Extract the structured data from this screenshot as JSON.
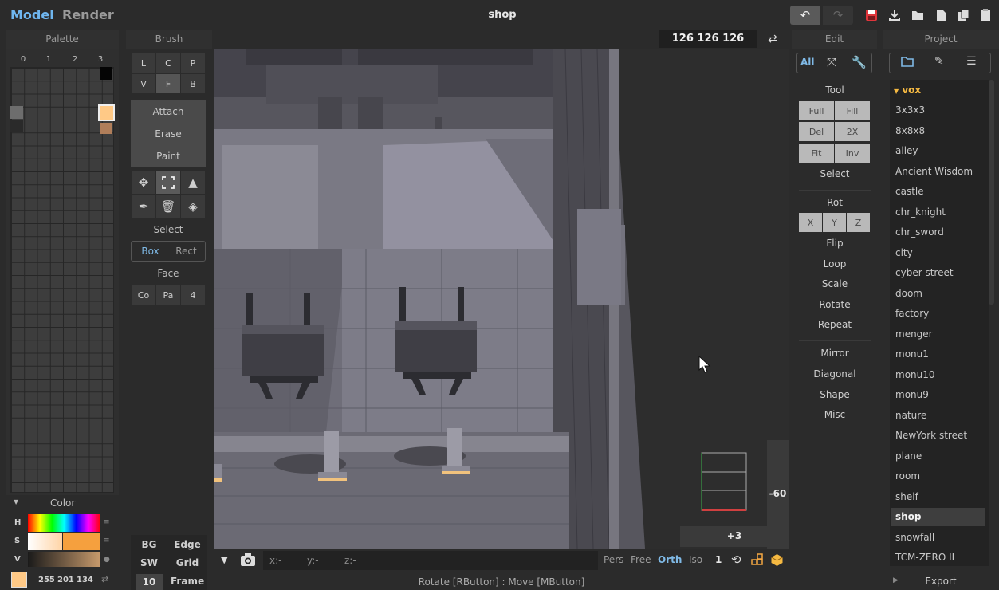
{
  "app": {
    "modes": [
      "Model",
      "Render"
    ],
    "title": "shop"
  },
  "toolbar_icons": [
    "undo-icon",
    "redo-icon",
    "save-icon",
    "import-icon",
    "open-icon",
    "new-file-icon",
    "copy-icon"
  ],
  "palette": {
    "header": "Palette",
    "columns": [
      "0",
      "1",
      "2",
      "3"
    ],
    "selected_color": "#ffc986",
    "color_section": "Color",
    "hsv_labels": [
      "H",
      "S",
      "V"
    ],
    "rgb": [
      "255",
      "201",
      "134"
    ]
  },
  "brush": {
    "header": "Brush",
    "mode_row1": [
      "L",
      "C",
      "P"
    ],
    "mode_row2": [
      "V",
      "F",
      "B"
    ],
    "actions": [
      "Attach",
      "Erase",
      "Paint"
    ],
    "select_label": "Select",
    "select_modes": [
      "Box",
      "Rect"
    ],
    "face_label": "Face",
    "face_modes": [
      "Co",
      "Pa",
      "4"
    ],
    "bottom": {
      "bg": "BG",
      "edge": "Edge",
      "sw": "SW",
      "grid": "Grid",
      "frame_value": "10",
      "frame": "Frame"
    }
  },
  "viewport": {
    "size_readout": "126  126  126",
    "axis_values": {
      "vertical": "-60",
      "horizontal": "+3"
    },
    "coords": {
      "x": "x:-",
      "y": "y:-",
      "z": "z:-"
    },
    "view_modes": [
      "Pers",
      "Free",
      "Orth",
      "Iso"
    ],
    "active_view": "Orth",
    "zoom_value": "1",
    "status": "Rotate [RButton] : Move [MButton]"
  },
  "edit": {
    "header": "Edit",
    "filters": [
      "All"
    ],
    "tool_label": "Tool",
    "tool_buttons": [
      "Full",
      "Fill",
      "Del",
      "2X",
      "Fit",
      "Inv"
    ],
    "select_label": "Select",
    "rot_label": "Rot",
    "rot_buttons": [
      "X",
      "Y",
      "Z"
    ],
    "ops": [
      "Flip",
      "Loop",
      "Scale",
      "Rotate",
      "Repeat"
    ],
    "ops2": [
      "Mirror",
      "Diagonal",
      "Shape",
      "Misc"
    ]
  },
  "project": {
    "header": "Project",
    "folder": "vox",
    "items": [
      "3x3x3",
      "8x8x8",
      "alley",
      "Ancient Wisdom",
      "castle",
      "chr_knight",
      "chr_sword",
      "city",
      "cyber street",
      "doom",
      "factory",
      "menger",
      "monu1",
      "monu10",
      "monu9",
      "nature",
      "NewYork street",
      "plane",
      "room",
      "shelf",
      "shop",
      "snowfall",
      "TCM-ZERO II"
    ],
    "selected": "shop",
    "export": "Export"
  }
}
